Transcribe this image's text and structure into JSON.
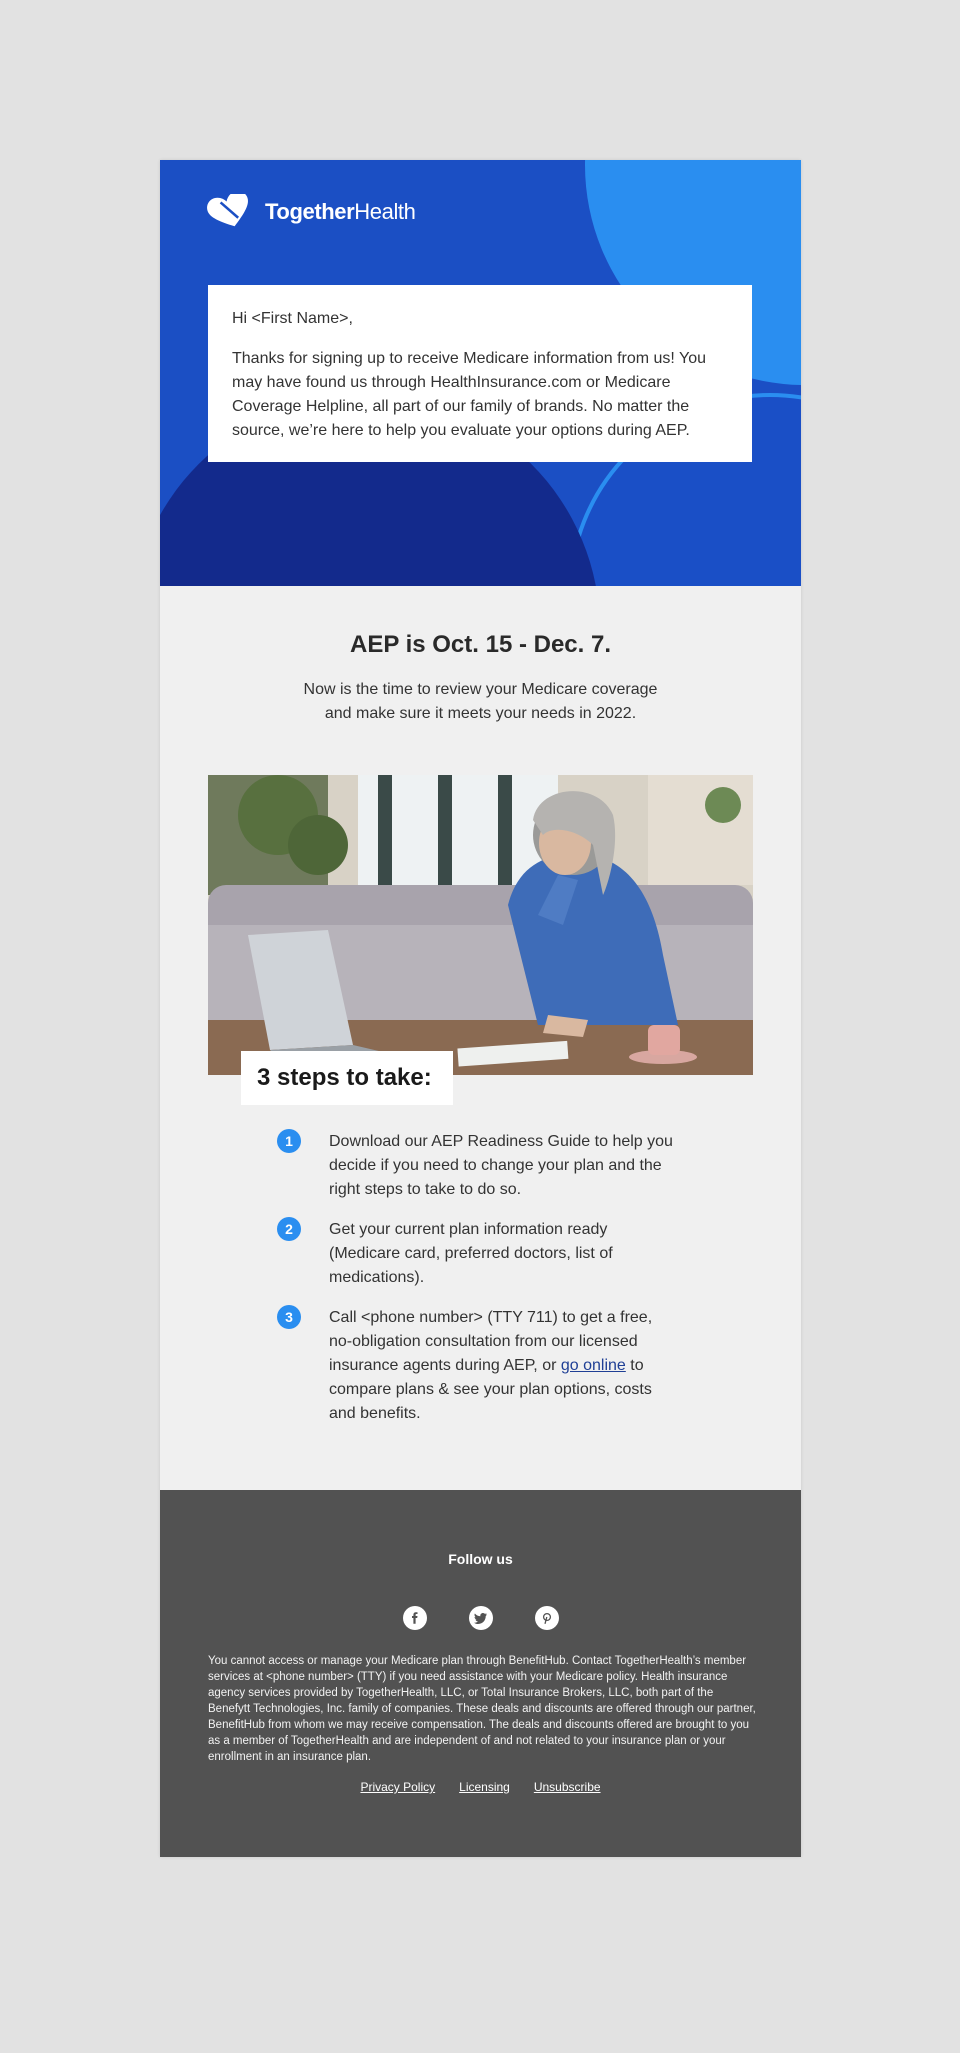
{
  "brand": {
    "name_bold": "Together",
    "name_light": "Health",
    "logo_icon": "heart-icon",
    "colors": {
      "hero_blue": "#1b4fc4",
      "light_blue": "#2a8ef0",
      "navy": "#132a8c",
      "footer": "#525252"
    }
  },
  "greeting": {
    "salutation": "Hi <First Name>,",
    "body": "Thanks for signing up to receive Medicare information from us! You may have found us through HealthInsurance.com or Medicare Coverage Helpline, all part of our family of brands. No matter the source, we’re here to help you evaluate your options during AEP."
  },
  "aep": {
    "headline": "AEP is Oct. 15 - Dec. 7.",
    "subtext": "Now is the time to review your Medicare coverage and make sure it meets your needs in 2022."
  },
  "steps_title": "3 steps to take:",
  "steps": [
    {
      "num": "1",
      "text": "Download our AEP Readiness Guide to help you decide if you need to change your plan and the right steps to take to do so."
    },
    {
      "num": "2",
      "text": "Get your current plan information ready (Medicare card, preferred doctors, list of medications)."
    },
    {
      "num": "3",
      "text_before": "Call <phone number> (TTY 711) to get a free, no-obligation consultation from our licensed insurance agents during AEP, or ",
      "link": "go online",
      "text_after": " to compare plans & see your plan options, costs and benefits."
    }
  ],
  "footer": {
    "follow": "Follow us",
    "socials": [
      "facebook-icon",
      "twitter-icon",
      "pinterest-icon"
    ],
    "disclaimer": "You cannot access or manage your Medicare plan through BenefitHub.  Contact TogetherHealth’s member services at <phone number> (TTY) if you need assistance with your Medicare policy. Health insurance agency services provided by TogetherHealth, LLC, or Total Insurance Brokers, LLC, both part of the Benefytt Technologies, Inc. family of companies. These deals and discounts are offered through our partner, BenefitHub from whom we may receive compensation. The deals and discounts offered are brought to you as a member of TogetherHealth and are independent of and not related to your insurance plan or your enrollment in an insurance plan.",
    "links": [
      "Privacy Policy",
      "Licensing",
      "Unsubscribe"
    ]
  }
}
